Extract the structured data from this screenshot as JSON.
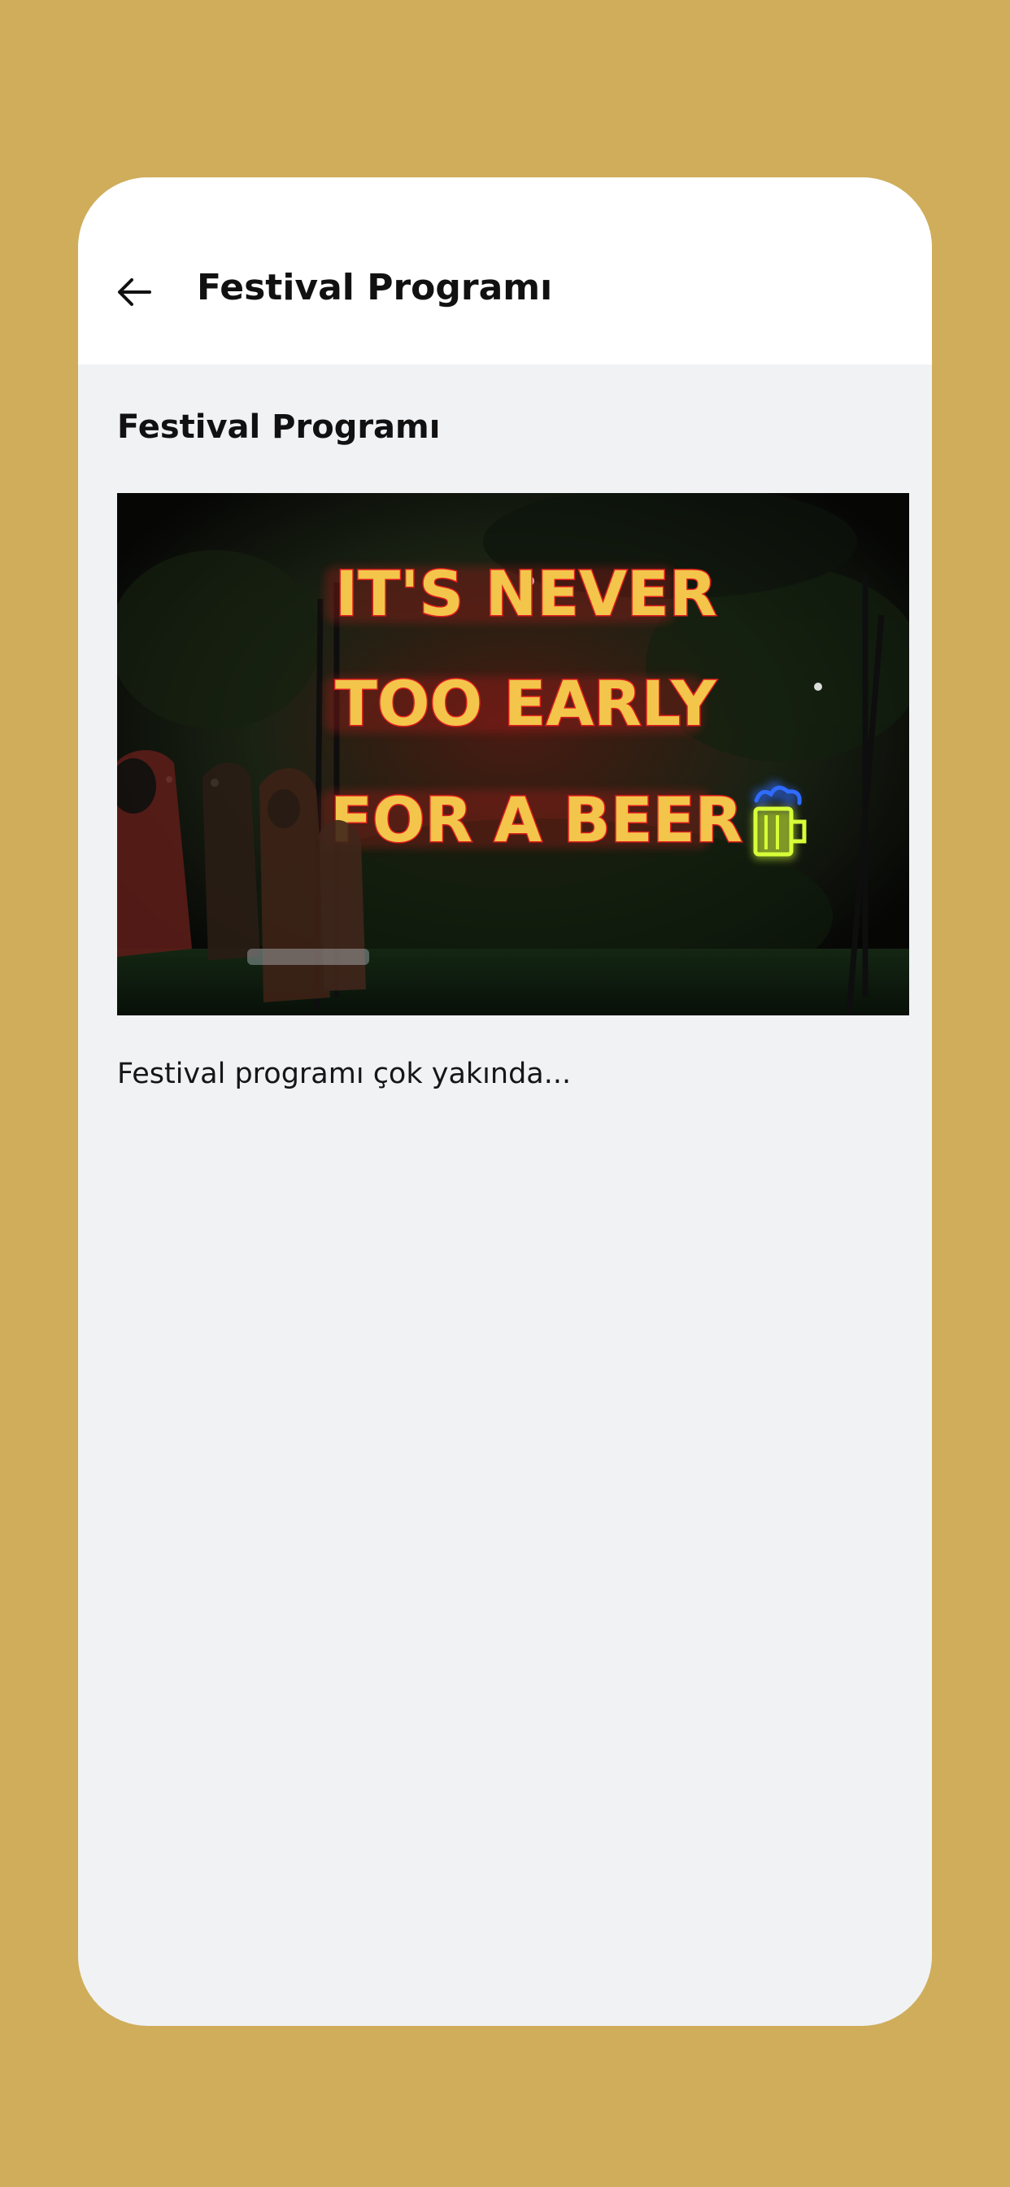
{
  "header": {
    "back_icon": "arrow-left-icon",
    "title": "Festival Programı"
  },
  "section": {
    "title": "Festival Programı"
  },
  "hero": {
    "lines": [
      "IT'S NEVER",
      "TOO EARLY",
      "FOR A BEER"
    ],
    "neon_icon": "beer-mug-icon"
  },
  "content": {
    "text": "Festival programı çok yakında..."
  },
  "colors": {
    "page_background": "#cfad5a",
    "header_background": "#ffffff",
    "content_background": "#f1f2f4",
    "neon_fill": "#f4c64a",
    "neon_glow": "#e02020",
    "neon_icon_blue": "#2f6bff",
    "neon_icon_lime": "#d7ff38"
  }
}
